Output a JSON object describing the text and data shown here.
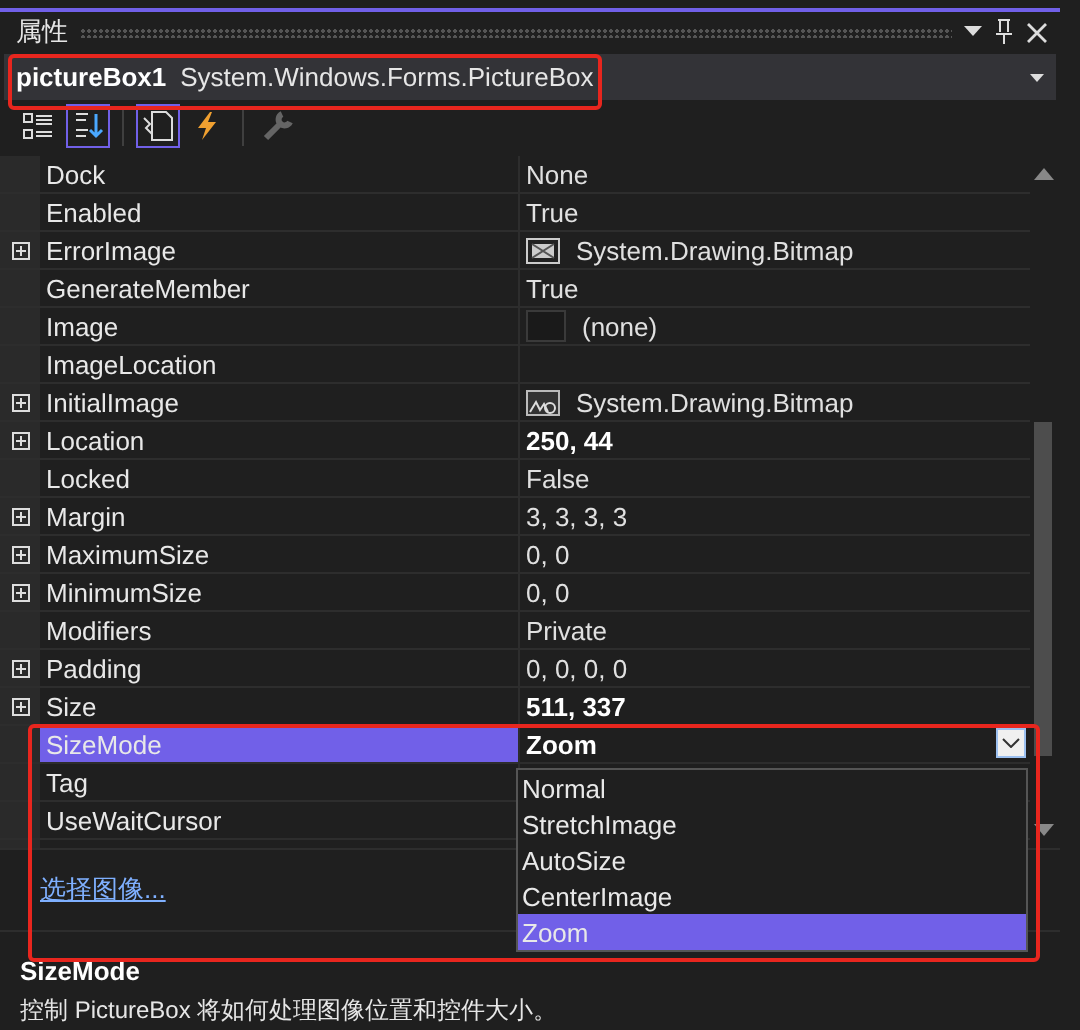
{
  "window": {
    "title": "属性"
  },
  "selector": {
    "name": "pictureBox1",
    "type": "System.Windows.Forms.PictureBox",
    "highlighted": true
  },
  "toolbar": [
    {
      "kind": "categorized",
      "selected": false,
      "disabled": false
    },
    {
      "kind": "alphabetical",
      "selected": true,
      "disabled": false
    },
    {
      "kind": "properties",
      "selected": true,
      "disabled": false
    },
    {
      "kind": "events",
      "selected": false,
      "disabled": false
    },
    {
      "kind": "property-pages",
      "selected": false,
      "disabled": true
    }
  ],
  "properties": [
    {
      "kind": "text",
      "name": "Dock",
      "value": "None",
      "expandable": false,
      "modified": false,
      "selected": false
    },
    {
      "kind": "text",
      "name": "Enabled",
      "value": "True",
      "expandable": false,
      "modified": false,
      "selected": false
    },
    {
      "kind": "error-image",
      "name": "ErrorImage",
      "value": "System.Drawing.Bitmap",
      "expandable": true,
      "modified": false,
      "selected": false
    },
    {
      "kind": "text",
      "name": "GenerateMember",
      "value": "True",
      "expandable": false,
      "modified": false,
      "selected": false
    },
    {
      "kind": "empty-image",
      "name": "Image",
      "value": "(none)",
      "expandable": false,
      "modified": false,
      "selected": false
    },
    {
      "kind": "text",
      "name": "ImageLocation",
      "expandable": false,
      "selected": false
    },
    {
      "kind": "image",
      "name": "InitialImage",
      "value": "System.Drawing.Bitmap",
      "expandable": true,
      "modified": false,
      "selected": false
    },
    {
      "kind": "text",
      "name": "Location",
      "value": "250, 44",
      "expandable": true,
      "modified": true,
      "selected": false
    },
    {
      "kind": "text",
      "name": "Locked",
      "value": "False",
      "expandable": false,
      "modified": false,
      "selected": false
    },
    {
      "kind": "text",
      "name": "Margin",
      "value": "3, 3, 3, 3",
      "expandable": true,
      "modified": false,
      "selected": false
    },
    {
      "kind": "text",
      "name": "MaximumSize",
      "value": "0, 0",
      "expandable": true,
      "modified": false,
      "selected": false
    },
    {
      "kind": "text",
      "name": "MinimumSize",
      "value": "0, 0",
      "expandable": true,
      "modified": false,
      "selected": false
    },
    {
      "kind": "text",
      "name": "Modifiers",
      "value": "Private",
      "expandable": false,
      "modified": false,
      "selected": false
    },
    {
      "kind": "text",
      "name": "Padding",
      "value": "0, 0, 0, 0",
      "expandable": true,
      "modified": false,
      "selected": false
    },
    {
      "kind": "text",
      "name": "Size",
      "value": "511, 337",
      "expandable": true,
      "modified": true,
      "selected": false
    },
    {
      "kind": "text",
      "name": "SizeMode",
      "value": "Zoom",
      "expandable": false,
      "modified": true,
      "selected": true
    },
    {
      "kind": "text",
      "name": "Tag",
      "expandable": false,
      "selected": false
    },
    {
      "kind": "text",
      "name": "UseWaitCursor",
      "expandable": false,
      "selected": false
    }
  ],
  "dropdown": {
    "highlighted": true,
    "options": [
      {
        "label": "Normal",
        "selected": false
      },
      {
        "label": "StretchImage",
        "selected": false
      },
      {
        "label": "AutoSize",
        "selected": false
      },
      {
        "label": "CenterImage",
        "selected": false
      },
      {
        "label": "Zoom",
        "selected": true
      }
    ]
  },
  "commands": {
    "link": "选择图像..."
  },
  "description": {
    "title": "SizeMode",
    "text": "控制 PictureBox 将如何处理图像位置和控件大小。"
  }
}
